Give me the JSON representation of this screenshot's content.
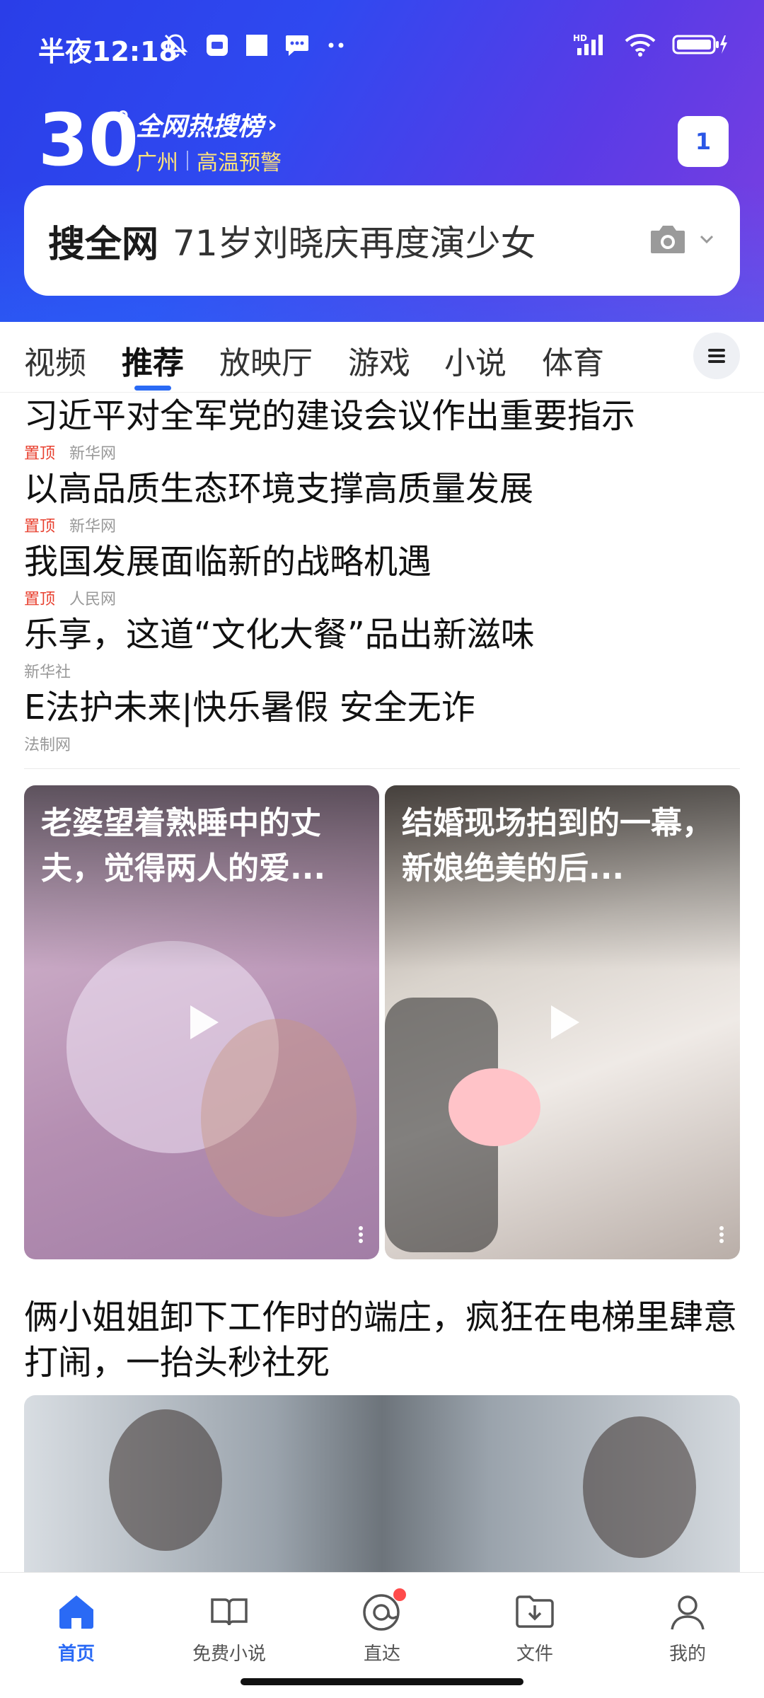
{
  "status_bar": {
    "time": "半夜12:18",
    "network": "HD"
  },
  "weather": {
    "temperature": "30",
    "degree": "°",
    "city": "广州",
    "alert": "高温预警"
  },
  "hot_list": {
    "label": "全网热搜榜",
    "chevron": "›"
  },
  "tab_count": "1",
  "search": {
    "brand": "搜全网",
    "query": "71岁刘晓庆再度演少女"
  },
  "channels": [
    "视频",
    "推荐",
    "放映厅",
    "游戏",
    "小说",
    "体育"
  ],
  "active_channel": "推荐",
  "news": [
    {
      "title": "习近平对全军党的建设会议作出重要指示",
      "pin": "置顶",
      "source": "新华网"
    },
    {
      "title": "以高品质生态环境支撑高质量发展",
      "pin": "置顶",
      "source": "新华网"
    },
    {
      "title": "我国发展面临新的战略机遇",
      "pin": "置顶",
      "source": "人民网"
    },
    {
      "title": "乐享，这道“文化大餐”品出新滋味",
      "pin": "",
      "source": "新华社"
    },
    {
      "title": "E法护未来|快乐暑假 安全无诈",
      "pin": "",
      "source": "法制网"
    }
  ],
  "videos": [
    {
      "title": "老婆望着熟睡中的丈夫，觉得两人的爱..."
    },
    {
      "title": "结婚现场拍到的一幕，新娘绝美的后..."
    }
  ],
  "article": {
    "title": "俩小姐姐卸下工作时的端庄，疯狂在电梯里肆意打闹，一抬头秒社死"
  },
  "bottom_nav": [
    {
      "label": "首页",
      "icon": "home-icon"
    },
    {
      "label": "免费小说",
      "icon": "book-icon"
    },
    {
      "label": "直达",
      "icon": "direct-icon"
    },
    {
      "label": "文件",
      "icon": "file-download-icon"
    },
    {
      "label": "我的",
      "icon": "profile-icon"
    }
  ],
  "colors": {
    "accent": "#2a6af5",
    "alert_yellow": "#ffe37a",
    "pin_red": "#e8402f"
  }
}
